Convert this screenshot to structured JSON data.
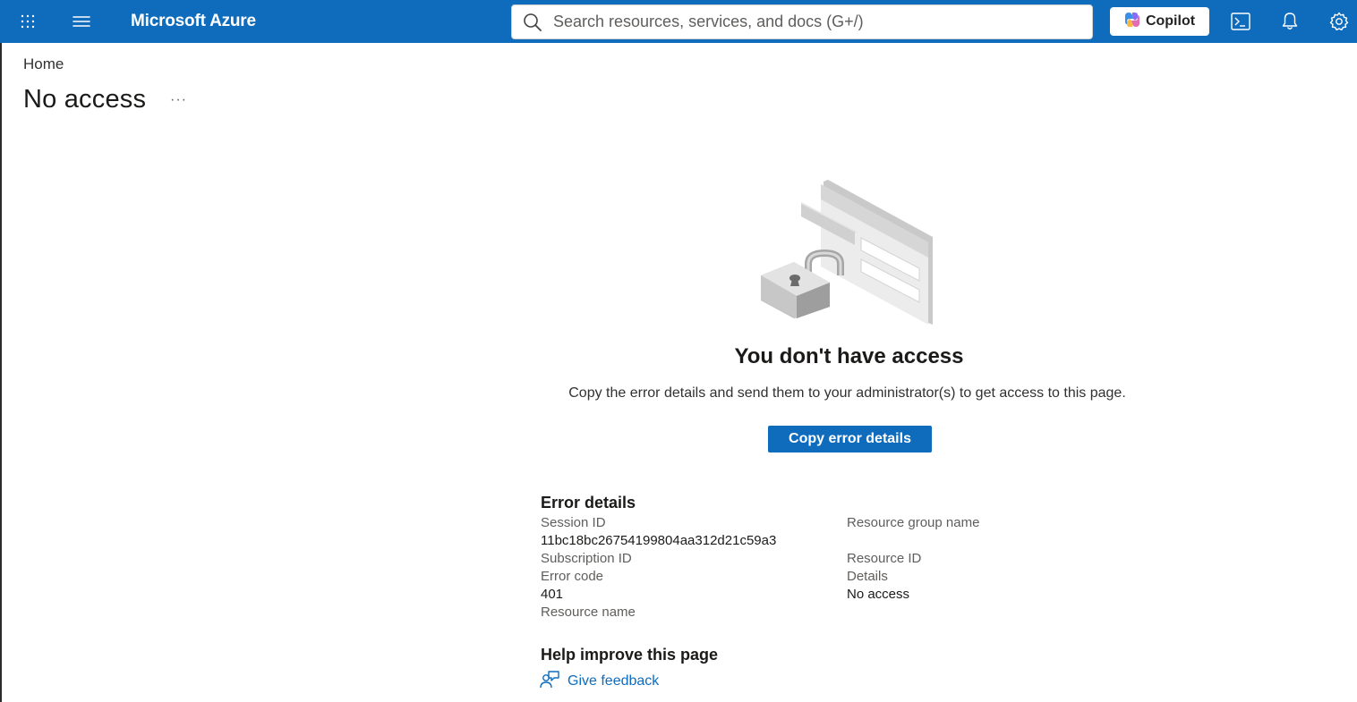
{
  "topbar": {
    "brand": "Microsoft Azure",
    "search_placeholder": "Search resources, services, and docs (G+/)",
    "copilot_label": "Copilot",
    "accent": "#0f6cbd"
  },
  "breadcrumb": "Home",
  "page": {
    "title": "No access",
    "more": "···"
  },
  "main": {
    "heading": "You don't have access",
    "message": "Copy the error details and send them to your administrator(s) to get access to this page.",
    "copy_button": "Copy error details"
  },
  "error_details": {
    "title": "Error details",
    "left": [
      {
        "label": "Session ID",
        "value": "11bc18bc26754199804aa312d21c59a3"
      },
      {
        "label": "Subscription ID",
        "value": ""
      },
      {
        "label": "Error code",
        "value": "401"
      },
      {
        "label": "Resource name",
        "value": ""
      }
    ],
    "right": [
      {
        "label": "Resource group name",
        "value": ""
      },
      {
        "label": "Resource ID",
        "value": ""
      },
      {
        "label": "Details",
        "value": "No access"
      }
    ]
  },
  "help": {
    "title": "Help improve this page",
    "feedback_label": "Give feedback"
  },
  "icons": [
    "waffle-icon",
    "hamburger-icon",
    "search-icon",
    "copilot-icon",
    "cloud-shell-icon",
    "bell-icon",
    "gear-icon",
    "feedback-icon",
    "lock-illustration"
  ]
}
